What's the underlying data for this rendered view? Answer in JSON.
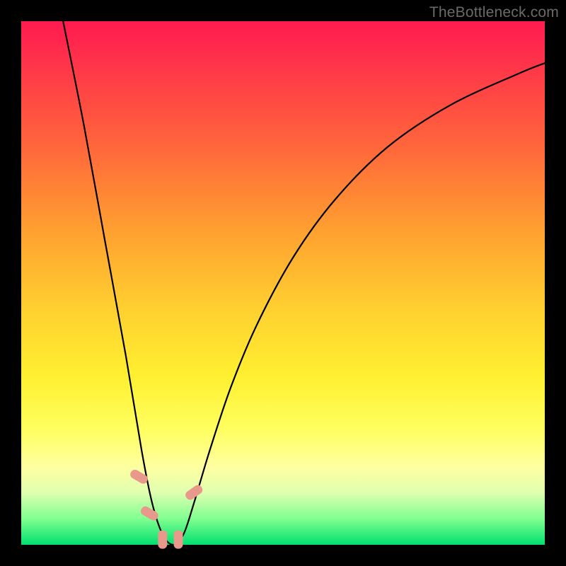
{
  "watermark": "TheBottleneck.com",
  "chart_data": {
    "type": "line",
    "title": "",
    "xlabel": "",
    "ylabel": "",
    "xlim": [
      0,
      100
    ],
    "ylim": [
      0,
      100
    ],
    "grid": false,
    "background": "rainbow-gradient-vertical",
    "series": [
      {
        "name": "bottleneck-curve",
        "comment": "V-shaped bottleneck curve; y≈100 is top (red/bad), y≈0 bottom (green/good). Minimum near x≈28.",
        "x": [
          8,
          12,
          16,
          20,
          23,
          25,
          27,
          29,
          31,
          33,
          36,
          40,
          45,
          52,
          60,
          70,
          82,
          95,
          100
        ],
        "y": [
          100,
          80,
          58,
          36,
          18,
          8,
          2,
          0,
          2,
          8,
          18,
          30,
          42,
          55,
          66,
          76,
          84,
          90,
          92
        ]
      }
    ],
    "markers": [
      {
        "name": "marker-left-1",
        "x": 22.5,
        "y": 13
      },
      {
        "name": "marker-left-2",
        "x": 24.5,
        "y": 6
      },
      {
        "name": "marker-bottom-1",
        "x": 27.0,
        "y": 1
      },
      {
        "name": "marker-bottom-2",
        "x": 30.0,
        "y": 1
      },
      {
        "name": "marker-right-1",
        "x": 33.0,
        "y": 10
      }
    ],
    "gradient_stops": [
      {
        "pos": 0,
        "color": "#ff1a50"
      },
      {
        "pos": 25,
        "color": "#ff6a3a"
      },
      {
        "pos": 55,
        "color": "#ffd030"
      },
      {
        "pos": 78,
        "color": "#ffff60"
      },
      {
        "pos": 100,
        "color": "#00e070"
      }
    ]
  }
}
